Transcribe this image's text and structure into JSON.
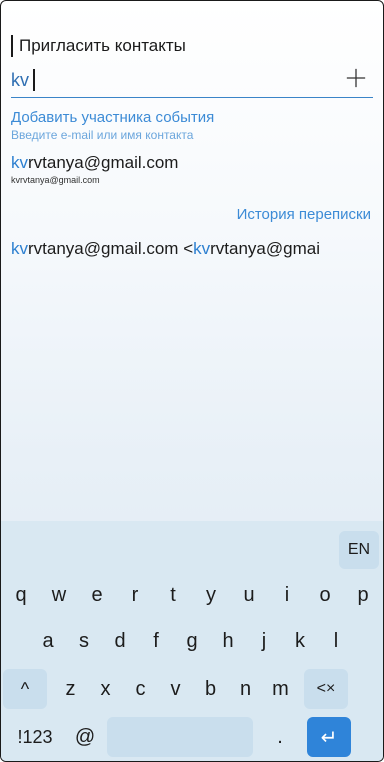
{
  "header": {
    "title": "Пригласить контакты"
  },
  "search": {
    "value": "kv",
    "add_icon": "plus-icon"
  },
  "hint": {
    "primary": "Добавить участника события",
    "secondary": "Введите e-mail или имя контакта"
  },
  "suggestion": {
    "match": "kv",
    "rest": "rvtanya@gmail.com",
    "sub_match": "kv",
    "sub_rest": "rvtanya@gmail.com"
  },
  "history": {
    "label": "История переписки",
    "item_match1": "kv",
    "item_rest1": "rvtanya@gmail.com <",
    "item_match2": "kv",
    "item_rest2": "rvtanya@gmai"
  },
  "keyboard": {
    "language": "EN",
    "row1": [
      "q",
      "w",
      "e",
      "r",
      "t",
      "y",
      "u",
      "i",
      "o",
      "p"
    ],
    "row2": [
      "a",
      "s",
      "d",
      "f",
      "g",
      "h",
      "j",
      "k",
      "l"
    ],
    "shift": "^",
    "row3": [
      "z",
      "x",
      "c",
      "v",
      "b",
      "n",
      "m"
    ],
    "backspace": "<×",
    "symbols": "!123",
    "at": "@",
    "dot": ".",
    "enter": "↵"
  },
  "colors": {
    "accent": "#2c7fd0",
    "hint": "#3c8bd6",
    "enter": "#2f84d9"
  }
}
